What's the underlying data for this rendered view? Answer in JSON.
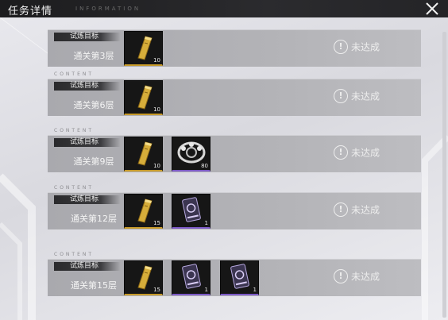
{
  "header": {
    "title": "任务详情",
    "deco_text": "INFORMATION"
  },
  "colors": {
    "gold_border": "#c89b2a",
    "purple_border": "#7d5ac7",
    "row_bg": "#b0b0b4"
  },
  "deco": {
    "content_text": "CONTENT"
  },
  "tasks": [
    {
      "tag": "试炼目标",
      "label": "通关第3层",
      "status": "未达成",
      "rewards": [
        {
          "icon": "gold-bar-icon",
          "qty": "10"
        }
      ]
    },
    {
      "tag": "试炼目标",
      "label": "通关第6层",
      "status": "未达成",
      "rewards": [
        {
          "icon": "gold-bar-icon",
          "qty": "10"
        }
      ]
    },
    {
      "tag": "试炼目标",
      "label": "通关第9层",
      "status": "未达成",
      "rewards": [
        {
          "icon": "gold-bar-icon",
          "qty": "10"
        },
        {
          "icon": "silver-ornament-icon",
          "qty": "80"
        }
      ]
    },
    {
      "tag": "试炼目标",
      "label": "通关第12层",
      "status": "未达成",
      "rewards": [
        {
          "icon": "gold-bar-icon",
          "qty": "15"
        },
        {
          "icon": "card-pack-icon",
          "qty": "1"
        }
      ]
    },
    {
      "tag": "试炼目标",
      "label": "通关第15层",
      "status": "未达成",
      "rewards": [
        {
          "icon": "gold-bar-icon",
          "qty": "15"
        },
        {
          "icon": "card-pack-icon",
          "qty": "1"
        },
        {
          "icon": "card-pack-icon",
          "qty": "1"
        }
      ]
    }
  ]
}
